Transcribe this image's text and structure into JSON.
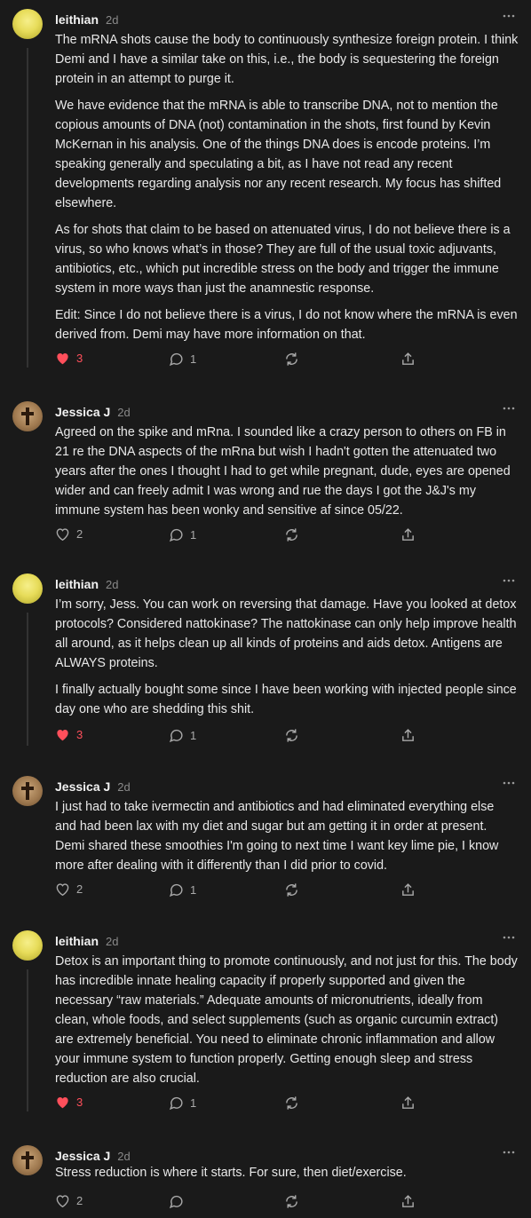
{
  "comments": [
    {
      "author": "leithian",
      "time": "2d",
      "avatar": "blonde-avatar",
      "paragraphs": [
        "The mRNA shots cause the body to continuously synthesize foreign protein. I think Demi and I have a similar take on this, i.e., the body is sequestering the foreign protein in an attempt to purge it.",
        "We have evidence that the mRNA is able to transcribe DNA, not to mention the copious amounts of DNA (not) contamination in the shots, first found by Kevin McKernan in his analysis. One of the things DNA does is encode proteins. I’m speaking generally and speculating a bit, as I have not read any recent developments regarding analysis nor any recent research. My focus has shifted elsewhere.",
        "As for shots that claim to be based on attenuated virus, I do not believe there is a virus, so who knows what’s in those? They are full of the usual toxic adjuvants, antibiotics, etc., which put incredible stress on the body and trigger the immune system in more ways than just the anamnestic response.",
        "Edit: Since I do not believe there is a virus, I do not know where the mRNA is even derived from. Demi may have more information on that."
      ],
      "likes": "3",
      "liked": true,
      "replies": "1"
    },
    {
      "author": "Jessica J",
      "time": "2d",
      "avatar": "cross-avatar",
      "paragraphs": [
        "Agreed on the spike and mRna. I sounded like a crazy person to others on FB in 21 re the DNA aspects of the mRna but wish I hadn't gotten the attenuated two years after the ones I thought I had to get while pregnant, dude, eyes are opened wider and can freely admit I was wrong and rue the days I got the J&J's my immune system has been wonky and sensitive af since 05/22."
      ],
      "likes": "2",
      "liked": false,
      "replies": "1"
    },
    {
      "author": "leithian",
      "time": "2d",
      "avatar": "blonde-avatar",
      "paragraphs": [
        "I’m sorry, Jess. You can work on reversing that damage. Have you looked at detox protocols? Considered nattokinase? The nattokinase can only help improve health all around, as it helps clean up all kinds of proteins and aids detox. Antigens are ALWAYS proteins.",
        "I finally actually bought some since I have been working with injected people since day one who are shedding this shit."
      ],
      "likes": "3",
      "liked": true,
      "replies": "1"
    },
    {
      "author": "Jessica J",
      "time": "2d",
      "avatar": "cross-avatar",
      "paragraphs": [
        "I just had to take ivermectin and antibiotics and had eliminated everything else and had been lax with my diet and sugar but am getting it in order at present. Demi shared these smoothies I'm going to next time I want key lime pie, I know more after dealing with it differently than I did prior to covid."
      ],
      "likes": "2",
      "liked": false,
      "replies": "1"
    },
    {
      "author": "leithian",
      "time": "2d",
      "avatar": "blonde-avatar",
      "paragraphs": [
        "Detox is an important thing to promote continuously, and not just for this. The body has incredible innate healing capacity if properly supported and given the necessary “raw materials.” Adequate amounts of micronutrients, ideally from clean, whole foods, and select supplements (such as organic curcumin extract) are extremely beneficial. You need to eliminate chronic inflammation and allow your immune system to function properly. Getting enough sleep and stress reduction are also crucial."
      ],
      "likes": "3",
      "liked": true,
      "replies": "1"
    },
    {
      "author": "Jessica J",
      "time": "2d",
      "avatar": "cross-avatar",
      "paragraphs": [
        "Stress reduction is where it starts. For sure, then diet/exercise."
      ],
      "likes": "2",
      "liked": false,
      "replies": ""
    }
  ],
  "icons": {
    "like": "heart-icon",
    "reply": "speech-bubble-icon",
    "restack": "restack-icon",
    "share": "share-icon",
    "more": "ellipsis-icon"
  },
  "colors": {
    "background": "#1a1a1a",
    "liked": "#ff4f5b",
    "muted": "#8a8a8a"
  }
}
